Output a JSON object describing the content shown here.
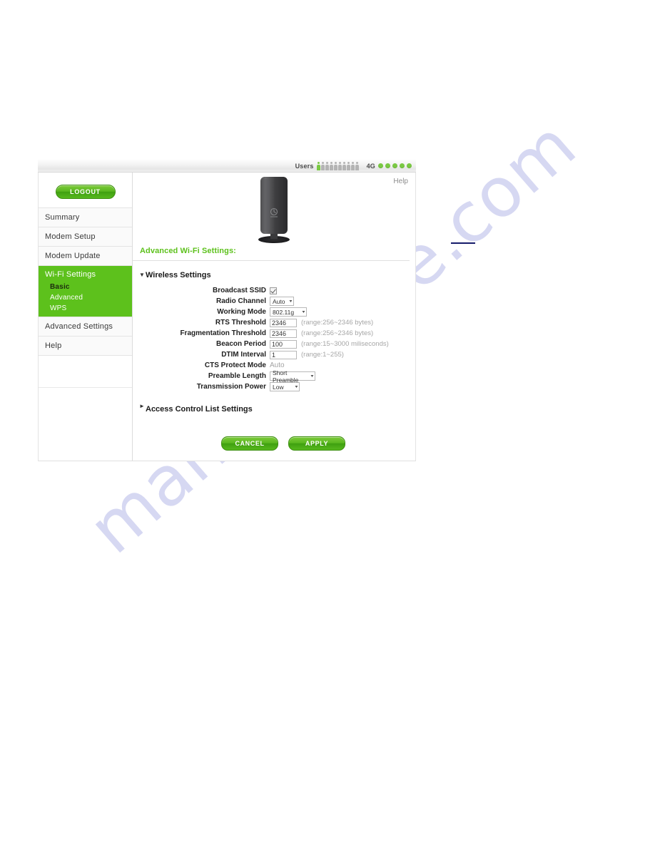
{
  "watermark": {
    "text": "manualshive.com"
  },
  "status_bar": {
    "users_label": "Users",
    "users_total": 10,
    "users_active": 1,
    "network_label": "4G",
    "signal_dots": 5,
    "active_color": "#7ac943",
    "inactive_color": "#b4b4b4"
  },
  "sidebar": {
    "logout_label": "LOGOUT",
    "items": [
      {
        "label": "Summary"
      },
      {
        "label": "Modem Setup"
      },
      {
        "label": "Modem Update"
      }
    ],
    "active_group": {
      "label": "Wi-Fi Settings",
      "sub_items": [
        {
          "label": "Basic"
        },
        {
          "label": "Advanced"
        },
        {
          "label": "WPS"
        }
      ]
    },
    "items_after": [
      {
        "label": "Advanced Settings"
      },
      {
        "label": "Help"
      }
    ],
    "active_color": "#5dc11c"
  },
  "content": {
    "help_label": "Help",
    "device_icon": "router-device-image",
    "page_title": "Advanced Wi-Fi Settings:",
    "sections": {
      "wireless": {
        "caret": "▼",
        "label": "Wireless Settings"
      },
      "acl": {
        "caret": "►",
        "label": "Access Control List Settings"
      }
    },
    "fields": [
      {
        "label": "Broadcast SSID",
        "type": "checkbox",
        "checked": true,
        "hint": ""
      },
      {
        "label": "Radio Channel",
        "type": "select",
        "value": "Auto",
        "width_class": "w-auto",
        "hint": ""
      },
      {
        "label": "Working Mode",
        "type": "select",
        "value": "802.11g",
        "width_class": "w-mode",
        "hint": ""
      },
      {
        "label": "RTS Threshold",
        "type": "text",
        "value": "2346",
        "width_class": "",
        "hint": "(range:256~2346 bytes)"
      },
      {
        "label": "Fragmentation Threshold",
        "type": "text",
        "value": "2346",
        "width_class": "",
        "hint": "(range:256~2346 bytes)"
      },
      {
        "label": "Beacon Period",
        "type": "text",
        "value": "100",
        "width_class": "w-beacon",
        "hint": "(range:15~3000 miliseconds)"
      },
      {
        "label": "DTIM Interval",
        "type": "text",
        "value": "1",
        "width_class": "w-dtim",
        "hint": "(range:1~255)"
      },
      {
        "label": "CTS Protect Mode",
        "type": "readonly",
        "value": "Auto",
        "hint": ""
      },
      {
        "label": "Preamble Length",
        "type": "select",
        "value": "Short Preamble",
        "width_class": "w-pre",
        "hint": ""
      },
      {
        "label": "Transmission Power",
        "type": "select",
        "value": "Low",
        "width_class": "w-pow",
        "hint": ""
      }
    ],
    "buttons": {
      "cancel_label": "CANCEL",
      "apply_label": "APPLY"
    }
  }
}
